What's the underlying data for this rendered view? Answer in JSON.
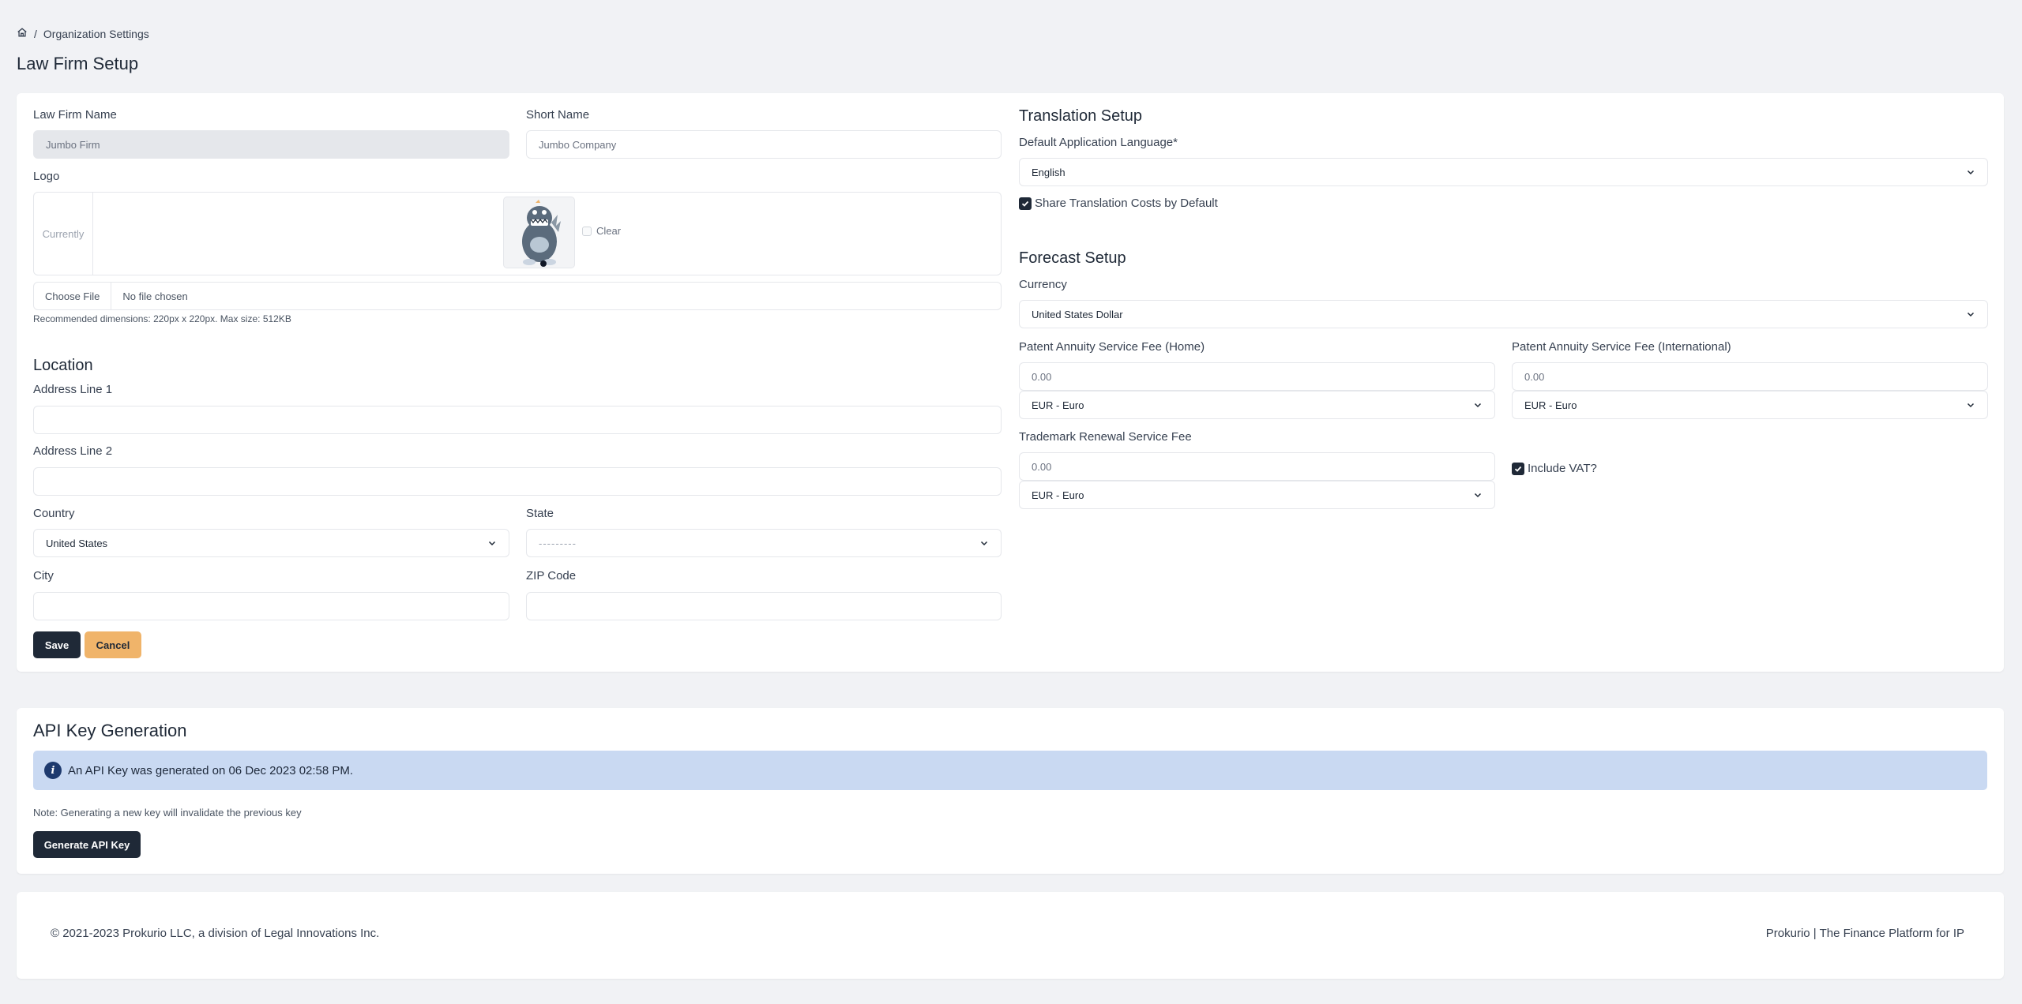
{
  "breadcrumb": {
    "home_icon": "home-icon",
    "separator": "/",
    "current": "Organization Settings"
  },
  "page": {
    "title": "Law Firm Setup"
  },
  "firm": {
    "name_label": "Law Firm Name",
    "name_value": "Jumbo Firm",
    "short_label": "Short Name",
    "short_value": "Jumbo Company",
    "logo_label": "Logo",
    "logo_currently": "Currently",
    "logo_clear": "Clear",
    "file_button": "Choose File",
    "file_status": "No file chosen",
    "file_hint": "Recommended dimensions: 220px x 220px. Max size: 512KB"
  },
  "location": {
    "title": "Location",
    "address1_label": "Address Line 1",
    "address1_value": "",
    "address2_label": "Address Line 2",
    "address2_value": "",
    "country_label": "Country",
    "country_value": "United States",
    "state_label": "State",
    "state_value": "---------",
    "city_label": "City",
    "city_value": "",
    "zip_label": "ZIP Code",
    "zip_value": ""
  },
  "actions": {
    "save": "Save",
    "cancel": "Cancel"
  },
  "translation": {
    "title": "Translation Setup",
    "language_label": "Default Application Language*",
    "language_value": "English",
    "share_costs_label": "Share Translation Costs by Default",
    "share_costs_checked": true
  },
  "forecast": {
    "title": "Forecast Setup",
    "currency_label": "Currency",
    "currency_value": "United States Dollar",
    "patent_home_label": "Patent Annuity Service Fee (Home)",
    "patent_home_value": "0.00",
    "patent_home_currency": "EUR - Euro",
    "patent_intl_label": "Patent Annuity Service Fee (International)",
    "patent_intl_value": "0.00",
    "patent_intl_currency": "EUR - Euro",
    "trademark_label": "Trademark Renewal Service Fee",
    "trademark_value": "0.00",
    "trademark_currency": "EUR - Euro",
    "vat_label": "Include VAT?",
    "vat_checked": true
  },
  "api": {
    "title": "API Key Generation",
    "alert": "An API Key was generated on 06 Dec 2023 02:58 PM.",
    "note": "Note: Generating a new key will invalidate the previous key",
    "generate_button": "Generate API Key"
  },
  "footer": {
    "copyright": "© 2021-2023 Prokurio LLC, a division of Legal Innovations Inc.",
    "tagline": "Prokurio | The Finance Platform for IP"
  },
  "colors": {
    "background": "#f1f2f5",
    "primary_dark": "#1f2937",
    "cancel_amber": "#f0b46a",
    "alert_bg": "#c9d9f2",
    "info_icon": "#1e3a6e"
  }
}
